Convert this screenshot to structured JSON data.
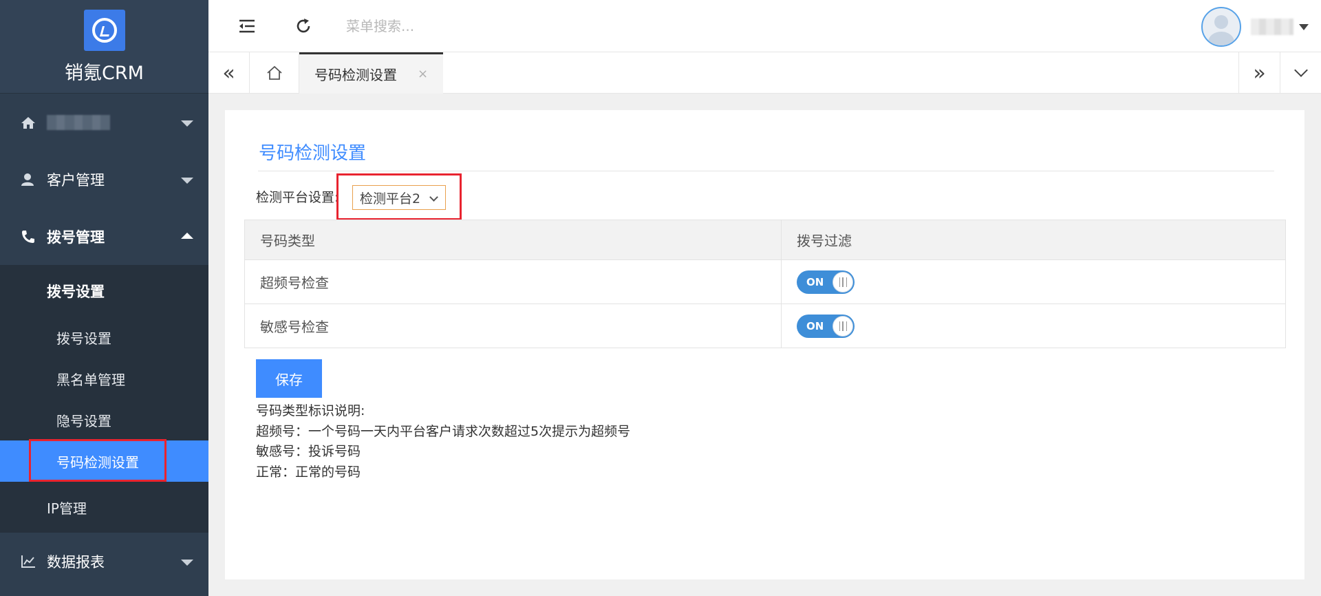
{
  "brand": {
    "title": "销氪CRM"
  },
  "sidebar": {
    "items": [
      {
        "label": "",
        "icon": "home-icon"
      },
      {
        "label": "客户管理",
        "icon": "user-icon"
      },
      {
        "label": "拨号管理",
        "icon": "phone-icon"
      },
      {
        "label": "数据报表",
        "icon": "chart-icon"
      }
    ],
    "submenu": {
      "header": "拨号设置",
      "items": [
        "拨号设置",
        "黑名单管理",
        "隐号设置",
        "号码检测设置"
      ],
      "ip": "IP管理"
    }
  },
  "topbar": {
    "search_placeholder": "菜单搜索..."
  },
  "tabs": {
    "active_label": "号码检测设置",
    "close_glyph": "×"
  },
  "page": {
    "title": "号码检测设置",
    "platform_label": "检测平台设置:",
    "platform_value": "检测平台2",
    "table": {
      "headers": [
        "号码类型",
        "拨号过滤"
      ],
      "rows": [
        {
          "type": "超频号检查",
          "toggle": "ON"
        },
        {
          "type": "敏感号检查",
          "toggle": "ON"
        }
      ]
    },
    "save_label": "保存",
    "notes": [
      "号码类型标识说明:",
      "超频号：一个号码一天内平台客户请求次数超过5次提示为超频号",
      "敏感号：投诉号码",
      "正常：正常的号码"
    ]
  },
  "colors": {
    "accent": "#3f8cff",
    "highlight": "#e8232f",
    "sidebar": "#2f3e4f"
  }
}
